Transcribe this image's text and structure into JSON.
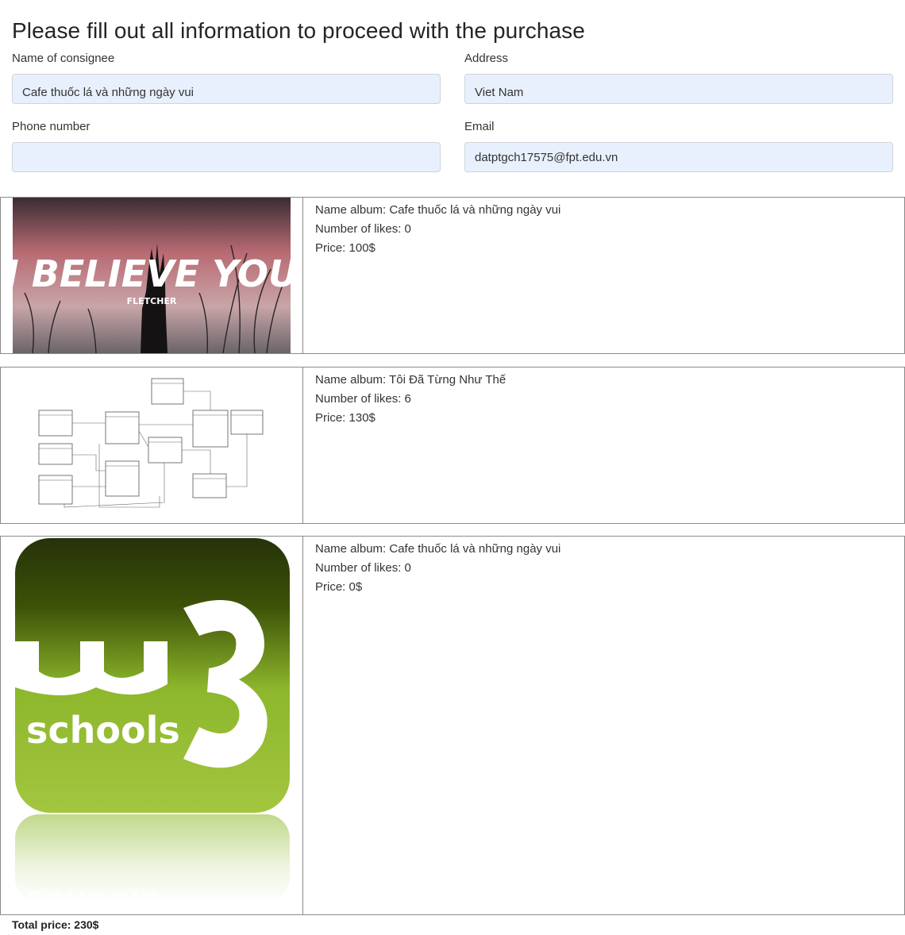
{
  "page": {
    "title": "Please fill out all information to proceed with the purchase"
  },
  "form": {
    "consignee": {
      "label": "Name of consignee",
      "value": "Cafe thuốc lá và những ngày vui",
      "placeholder": ""
    },
    "address": {
      "label": "Address",
      "value": "Viet Nam",
      "placeholder": ""
    },
    "phone": {
      "label": "Phone number",
      "value": "",
      "placeholder": ""
    },
    "email": {
      "label": "Email",
      "value": "datptgch17575@fpt.edu.vn",
      "placeholder": ""
    }
  },
  "albums": [
    {
      "name_line": "Name album: Cafe thuốc lá và những ngày vui",
      "likes_line": "Number of likes: 0",
      "price_line": "Price: 100$",
      "image_text": "I BELIEVE YOU",
      "image_subtext": "FLETCHER"
    },
    {
      "name_line": "Name album: Tôi Đã Từng Như Thế",
      "likes_line": "Number of likes: 6",
      "price_line": "Price: 130$"
    },
    {
      "name_line": "Name album: Cafe thuốc lá và những ngày vui",
      "likes_line": "Number of likes: 0",
      "price_line": "Price: 0$",
      "image_text": "schools"
    }
  ],
  "total": {
    "label": "Total price: 230$"
  },
  "colors": {
    "input_bg": "#e8f0fe",
    "border": "#8a8a8a",
    "w3_green_top": "#2d3a00",
    "w3_green_bottom": "#9cc33a"
  }
}
